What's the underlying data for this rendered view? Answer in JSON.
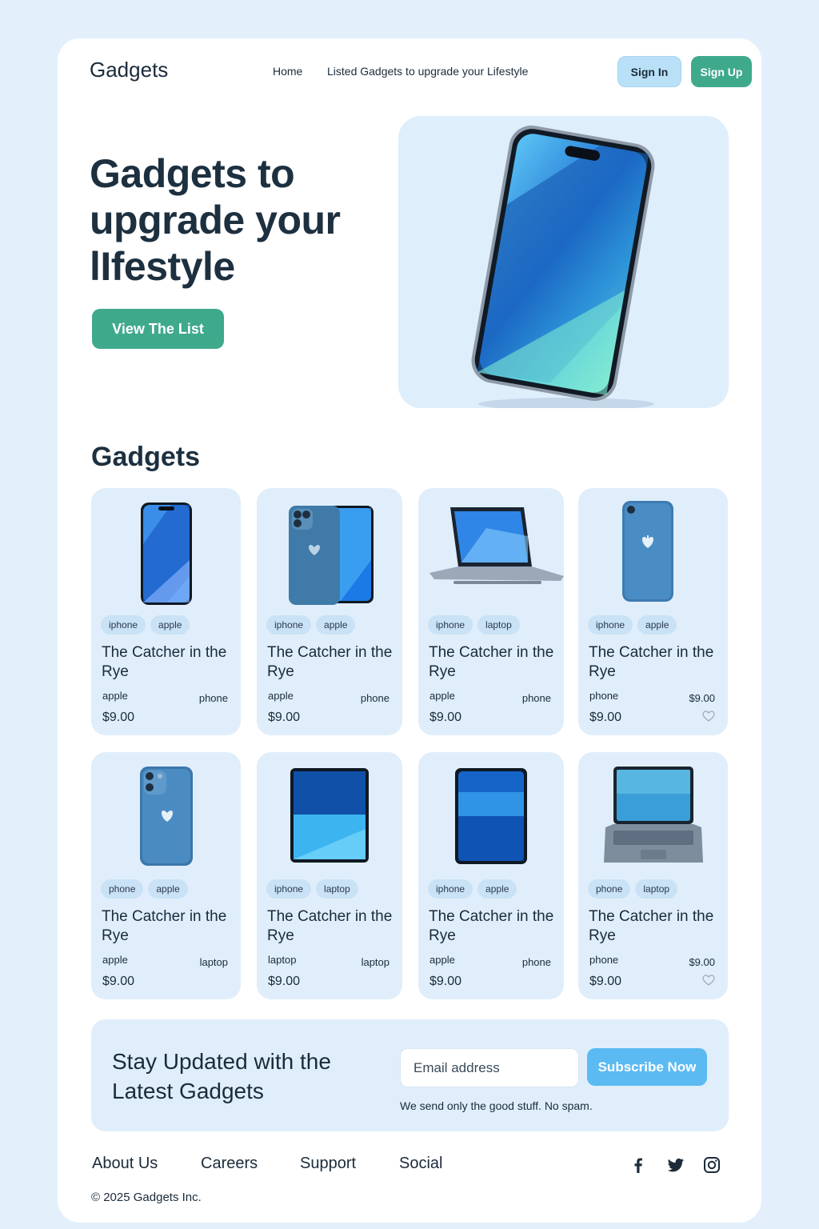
{
  "header": {
    "brand": "Gadgets",
    "nav": [
      "Home",
      "Listed Gadgets to upgrade your Lifestyle"
    ],
    "sign_in": "Sign In",
    "sign_up": "Sign Up"
  },
  "hero": {
    "title": "Gadgets to upgrade your lIfestyle",
    "cta": "View The List"
  },
  "section_title": "Gadgets",
  "products": [
    {
      "image": "iphone-front-icon",
      "tags": [
        "iphone",
        "apple"
      ],
      "title": "The Catcher in the Rye",
      "meta_left": "apple",
      "meta_right": "phone",
      "price": "$9.00",
      "favorite": false
    },
    {
      "image": "iphone-pair-icon",
      "tags": [
        "iphone",
        "apple"
      ],
      "title": "The Catcher in the Rye",
      "meta_left": "apple",
      "meta_right": "phone",
      "price": "$9.00",
      "favorite": false
    },
    {
      "image": "laptop-open-icon",
      "tags": [
        "iphone",
        "laptop"
      ],
      "title": "The Catcher in the Rye",
      "meta_left": "apple",
      "meta_right": "phone",
      "price": "$9.00",
      "favorite": false
    },
    {
      "image": "iphone-back-icon",
      "tags": [
        "iphone",
        "apple"
      ],
      "title": "The Catcher in the Rye",
      "meta_left": "phone",
      "meta_right": "$9.00",
      "price": "$9.00",
      "favorite": true
    },
    {
      "image": "iphone-back-dual-icon",
      "tags": [
        "phone",
        "apple"
      ],
      "title": "The Catcher in the Rye",
      "meta_left": "apple",
      "meta_right": "laptop",
      "price": "$9.00",
      "favorite": false
    },
    {
      "image": "tablet-icon",
      "tags": [
        "iphone",
        "laptop"
      ],
      "title": "The Catcher in the Rye",
      "meta_left": "laptop",
      "meta_right": "laptop",
      "price": "$9.00",
      "favorite": false
    },
    {
      "image": "tablet-portrait-icon",
      "tags": [
        "iphone",
        "apple"
      ],
      "title": "The Catcher in the Rye",
      "meta_left": "apple",
      "meta_right": "phone",
      "price": "$9.00",
      "favorite": false
    },
    {
      "image": "laptop-icon",
      "tags": [
        "phone",
        "laptop"
      ],
      "title": "The Catcher in the Rye",
      "meta_left": "phone",
      "meta_right": "$9.00",
      "price": "$9.00",
      "favorite": true
    }
  ],
  "newsletter": {
    "title": "Stay Updated with the Latest Gadgets",
    "email_placeholder": "Email address",
    "button": "Subscribe Now",
    "note": "We send only the good stuff. No spam."
  },
  "footer": {
    "links": [
      "About Us",
      "Careers",
      "Support",
      "Social"
    ],
    "social_icons": [
      "facebook-icon",
      "twitter-icon",
      "instagram-icon"
    ],
    "copyright": "© 2025 Gadgets Inc."
  },
  "colors": {
    "background": "#e3f0fc",
    "accent_green": "#3fa98c",
    "accent_blue": "#5bbaf2",
    "card": "#e0eefb"
  }
}
